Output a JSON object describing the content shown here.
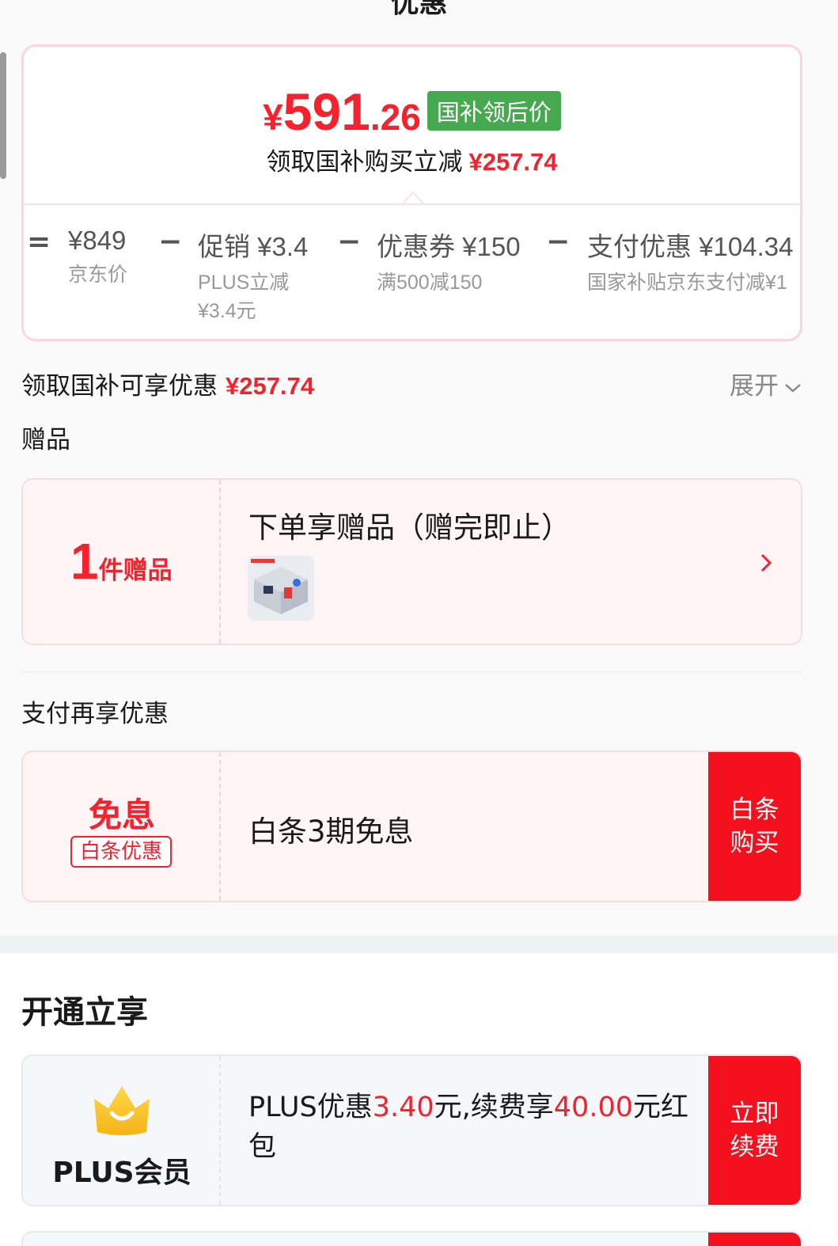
{
  "header": {
    "title": "优惠"
  },
  "price_card": {
    "currency": "¥",
    "price_int": "591",
    "price_dec": ".26",
    "badge": "国补领后价",
    "subline_label": "领取国补购买立减",
    "subline_amount": "¥257.74",
    "breakdown": [
      {
        "op": "=",
        "value": "¥849",
        "sub": [
          "京东价"
        ]
      },
      {
        "op": "−",
        "value": "促销 ¥3.4",
        "sub": [
          "PLUS立减",
          "¥3.4元"
        ]
      },
      {
        "op": "−",
        "value": "优惠券 ¥150",
        "sub": [
          "满500减150"
        ]
      },
      {
        "op": "−",
        "value": "支付优惠 ¥104.34",
        "sub": [
          "国家补贴京东支付减¥1"
        ]
      }
    ]
  },
  "national_subsidy": {
    "label": "领取国补可享优惠",
    "amount": "¥257.74",
    "expand_label": "展开"
  },
  "gifts": {
    "section_title": "赠品",
    "count": "1",
    "unit": "件赠品",
    "title": "下单享赠品（赠完即止）"
  },
  "payment": {
    "section_title": "支付再享优惠",
    "icon_title": "免息",
    "tag": "白条优惠",
    "text": "白条3期免息",
    "button_line1": "白条",
    "button_line2": "购买"
  },
  "open": {
    "section_title": "开通立享",
    "member_label": "PLUS会员",
    "text_1": "PLUS优惠",
    "amount_1": "3.40",
    "text_2": "元,续费享",
    "amount_2": "40.00",
    "text_3": "元红包",
    "button_line1": "立即",
    "button_line2": "续费"
  },
  "colors": {
    "accent_red": "#f5222d",
    "badge_green": "#46a84f",
    "button_red": "#f5101e"
  }
}
